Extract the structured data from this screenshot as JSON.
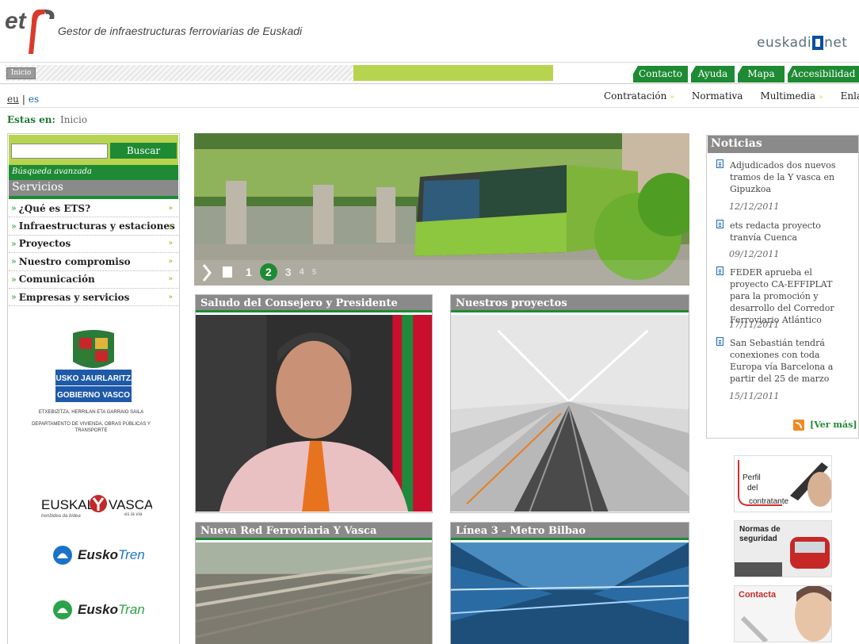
{
  "header": {
    "logo_text": "ets",
    "site_title": "Gestor de infraestructuras ferroviarias de Euskadi",
    "partner_logo": {
      "left": "euskadi",
      "right": "net"
    }
  },
  "topbar": {
    "home_label": "Inicio",
    "tabs": [
      {
        "label": "Contacto"
      },
      {
        "label": "Ayuda"
      },
      {
        "label": "Mapa"
      },
      {
        "label": "Accesibilidad"
      }
    ]
  },
  "language": {
    "eu": "eu",
    "separator": "|",
    "es": "es"
  },
  "menu": {
    "items": [
      {
        "label": "Contratación",
        "chevron": "»"
      },
      {
        "label": "Normativa",
        "chevron": ""
      },
      {
        "label": "Multimedia",
        "chevron": "»"
      },
      {
        "label": "Enlaces",
        "chevron": ""
      }
    ]
  },
  "breadcrumb": {
    "label": "Estas en:",
    "current": "Inicio"
  },
  "search": {
    "button": "Buscar",
    "advanced": "Búsqueda avanzada",
    "value": ""
  },
  "services": {
    "title": "Servicios",
    "items": [
      {
        "label": "¿Qué es ETS?"
      },
      {
        "label": "Infraestructuras y estaciones"
      },
      {
        "label": "Proyectos"
      },
      {
        "label": "Nuestro compromiso"
      },
      {
        "label": "Comunicación"
      },
      {
        "label": "Empresas y servicios"
      }
    ],
    "arrow": "»",
    "chevron": "»"
  },
  "left_logos": {
    "gov_line1": "EUSKO JAURLARITZA",
    "gov_line2": "GOBIERNO VASCO",
    "gov_dept1": "ETXEBIZITZA, HERRILAN ETA GARRAIO SAILA",
    "gov_dept2": "DEPARTAMENTO DE VIVIENDA, OBRAS PÚBLICAS Y TRANSPORTE",
    "euskal_y_left": "EUSKAL",
    "euskal_y_right": "VASCA",
    "euskal_y_sub_left": "trenbidea da bidea",
    "euskal_y_sub_right": "es la vía",
    "euskotren_a": "Eusko",
    "euskotren_b": "Tren",
    "euskotran_a": "Eusko",
    "euskotran_b": "Tran"
  },
  "hero": {
    "pages": [
      "1",
      "2",
      "3",
      "4",
      "5"
    ],
    "current_page": "2"
  },
  "panels": [
    {
      "title": "Saludo del Consejero y Presidente"
    },
    {
      "title": "Nuestros proyectos"
    },
    {
      "title": "Nueva Red Ferroviaria Y Vasca"
    },
    {
      "title": "Línea 3 - Metro Bilbao"
    }
  ],
  "news": {
    "title": "Noticias",
    "items": [
      {
        "title": "Adjudicados dos nuevos tramos de la Y vasca en Gipuzkoa",
        "date": "12/12/2011"
      },
      {
        "title": "ets redacta proyecto tranvía Cuenca",
        "date": "09/12/2011"
      },
      {
        "title": "FEDER aprueba el proyecto CA-EFFIPLAT para la promoción y desarrollo del Corredor Ferroviario Atlántico",
        "date": "17/11/2011"
      },
      {
        "title": "San Sebastián tendrá conexiones con toda Europa vía Barcelona a partir del 25 de marzo",
        "date": "15/11/2011"
      }
    ],
    "more": "[Ver más]"
  },
  "banners": {
    "perfil": [
      "Perfil",
      "del",
      "contratante"
    ],
    "normas": [
      "Normas de",
      "seguridad"
    ],
    "contacta": "Contacta"
  },
  "colors": {
    "green": "#1e8a33",
    "lime": "#b7d44f",
    "grey": "#8a8a8a"
  }
}
